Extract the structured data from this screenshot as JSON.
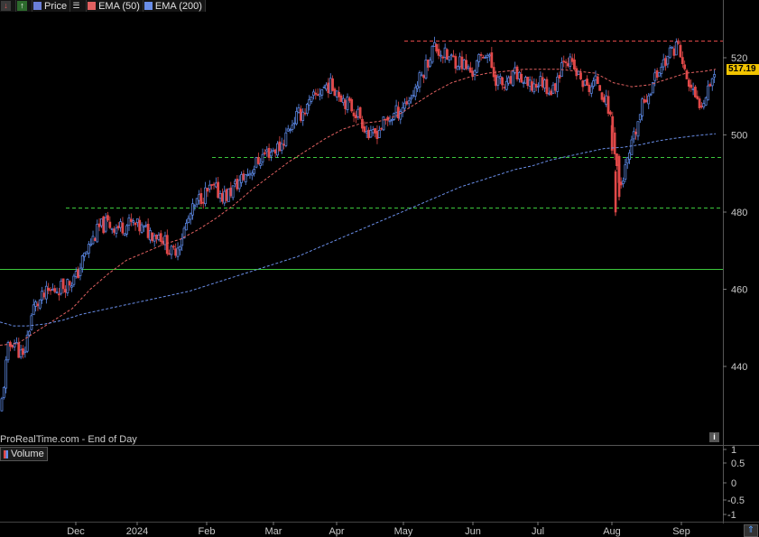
{
  "toolbar": {
    "items": [
      {
        "icon": "price-down-icon",
        "glyph": "↓"
      },
      {
        "icon": "price-up-icon",
        "glyph": "↑"
      },
      {
        "label": "Price",
        "color": "#6a7fd8"
      },
      {
        "icon": "menu-icon",
        "glyph": "☰"
      },
      {
        "label": "EMA (50)",
        "color": "#e06060"
      },
      {
        "label": "EMA (200)",
        "color": "#6a8ee8"
      }
    ]
  },
  "source_label": "ProRealTime.com - End of Day",
  "volume_label": "Volume",
  "last_price": "517.19",
  "info_icon": "i",
  "chart_data": {
    "type": "candlestick",
    "x_tick_labels": [
      "Dec",
      "2024",
      "Feb",
      "Mar",
      "Apr",
      "May",
      "Jun",
      "Jul",
      "Aug",
      "Sep"
    ],
    "y_ticks": [
      "440",
      "460",
      "480",
      "500",
      "520"
    ],
    "y_range": [
      426,
      530
    ],
    "volume_ticks": [
      "1",
      "0.5",
      "0",
      "-0.5",
      "-1"
    ],
    "colors": {
      "up": "#5f8ef0",
      "down": "#e04848",
      "ema50": "#e06060",
      "ema200": "#6a8ee8",
      "support": "#3cc83c",
      "resistance": "#e04848"
    },
    "reference_lines": [
      {
        "value": 524.5,
        "style": "dashed",
        "color": "#e04848"
      },
      {
        "value": 494.2,
        "style": "dashed",
        "color": "#3cc83c"
      },
      {
        "value": 481.1,
        "style": "dashed",
        "color": "#3cc83c"
      },
      {
        "value": 465.2,
        "style": "solid",
        "color": "#3cc83c"
      }
    ],
    "close_path": [
      [
        0,
        428
      ],
      [
        8,
        444
      ],
      [
        14,
        447
      ],
      [
        25,
        442
      ],
      [
        36,
        455
      ],
      [
        52,
        459
      ],
      [
        70,
        461
      ],
      [
        84,
        463
      ],
      [
        90,
        467
      ],
      [
        100,
        472
      ],
      [
        110,
        476
      ],
      [
        118,
        477
      ],
      [
        130,
        476
      ],
      [
        145,
        477
      ],
      [
        162,
        475
      ],
      [
        178,
        474
      ],
      [
        190,
        469
      ],
      [
        198,
        472
      ],
      [
        210,
        479
      ],
      [
        222,
        484
      ],
      [
        235,
        486
      ],
      [
        250,
        484
      ],
      [
        265,
        488
      ],
      [
        278,
        491
      ],
      [
        292,
        495
      ],
      [
        310,
        497
      ],
      [
        325,
        504
      ],
      [
        340,
        507
      ],
      [
        352,
        511
      ],
      [
        362,
        513
      ],
      [
        372,
        512
      ],
      [
        385,
        508
      ],
      [
        398,
        505
      ],
      [
        410,
        499
      ],
      [
        425,
        503
      ],
      [
        440,
        506
      ],
      [
        455,
        510
      ],
      [
        468,
        516
      ],
      [
        480,
        523
      ],
      [
        495,
        520
      ],
      [
        510,
        519
      ],
      [
        522,
        516
      ],
      [
        538,
        522
      ],
      [
        548,
        515
      ],
      [
        560,
        512
      ],
      [
        572,
        516
      ],
      [
        585,
        512
      ],
      [
        600,
        514
      ],
      [
        612,
        511
      ],
      [
        625,
        521
      ],
      [
        638,
        516
      ],
      [
        650,
        512
      ],
      [
        662,
        514
      ],
      [
        675,
        506
      ],
      [
        680,
        498
      ],
      [
        686,
        486
      ],
      [
        694,
        492
      ],
      [
        702,
        499
      ],
      [
        712,
        508
      ],
      [
        722,
        513
      ],
      [
        732,
        518
      ],
      [
        742,
        521
      ],
      [
        750,
        524
      ],
      [
        758,
        516
      ],
      [
        765,
        512
      ],
      [
        772,
        508
      ],
      [
        778,
        509
      ],
      [
        786,
        514
      ],
      [
        793,
        517.2
      ]
    ],
    "ema50": [
      [
        0,
        445.5
      ],
      [
        20,
        446
      ],
      [
        40,
        449
      ],
      [
        60,
        452
      ],
      [
        80,
        455
      ],
      [
        100,
        460
      ],
      [
        120,
        464
      ],
      [
        140,
        467.5
      ],
      [
        160,
        469.5
      ],
      [
        180,
        471.5
      ],
      [
        200,
        473
      ],
      [
        220,
        475.5
      ],
      [
        240,
        478.5
      ],
      [
        260,
        482
      ],
      [
        280,
        486
      ],
      [
        300,
        489.5
      ],
      [
        320,
        493
      ],
      [
        340,
        496
      ],
      [
        360,
        499
      ],
      [
        380,
        501.5
      ],
      [
        400,
        503
      ],
      [
        420,
        503.5
      ],
      [
        440,
        505
      ],
      [
        460,
        508
      ],
      [
        480,
        511
      ],
      [
        500,
        513.5
      ],
      [
        520,
        515
      ],
      [
        540,
        516
      ],
      [
        560,
        516.5
      ],
      [
        580,
        517
      ],
      [
        600,
        517
      ],
      [
        620,
        517
      ],
      [
        640,
        516.5
      ],
      [
        660,
        516
      ],
      [
        680,
        513.5
      ],
      [
        700,
        512.5
      ],
      [
        720,
        513
      ],
      [
        740,
        514.5
      ],
      [
        760,
        516
      ],
      [
        780,
        516.5
      ],
      [
        793,
        517
      ]
    ],
    "ema200": [
      [
        0,
        451.5
      ],
      [
        15,
        450.5
      ],
      [
        30,
        450.5
      ],
      [
        50,
        451
      ],
      [
        70,
        452
      ],
      [
        90,
        453.5
      ],
      [
        110,
        454.5
      ],
      [
        130,
        455.5
      ],
      [
        150,
        456.5
      ],
      [
        170,
        457.5
      ],
      [
        190,
        458.5
      ],
      [
        210,
        459.5
      ],
      [
        230,
        461
      ],
      [
        250,
        462.5
      ],
      [
        270,
        464
      ],
      [
        290,
        465.5
      ],
      [
        310,
        467
      ],
      [
        330,
        468.5
      ],
      [
        350,
        470.5
      ],
      [
        370,
        472.5
      ],
      [
        390,
        474.5
      ],
      [
        410,
        476.5
      ],
      [
        430,
        478.5
      ],
      [
        450,
        480.5
      ],
      [
        470,
        482.5
      ],
      [
        490,
        484.5
      ],
      [
        510,
        486.5
      ],
      [
        530,
        488
      ],
      [
        550,
        489.5
      ],
      [
        570,
        491
      ],
      [
        590,
        492
      ],
      [
        610,
        493.5
      ],
      [
        630,
        494.5
      ],
      [
        650,
        495.5
      ],
      [
        670,
        496.5
      ],
      [
        690,
        496.8
      ],
      [
        710,
        497.5
      ],
      [
        730,
        498.5
      ],
      [
        750,
        499.2
      ],
      [
        770,
        499.8
      ],
      [
        793,
        500.3
      ]
    ],
    "spikes": [
      {
        "x": 678,
        "low": 495,
        "high": 503
      },
      {
        "x": 682,
        "low": 479,
        "high": 491
      },
      {
        "x": 686,
        "low": 483,
        "high": 495
      }
    ]
  }
}
